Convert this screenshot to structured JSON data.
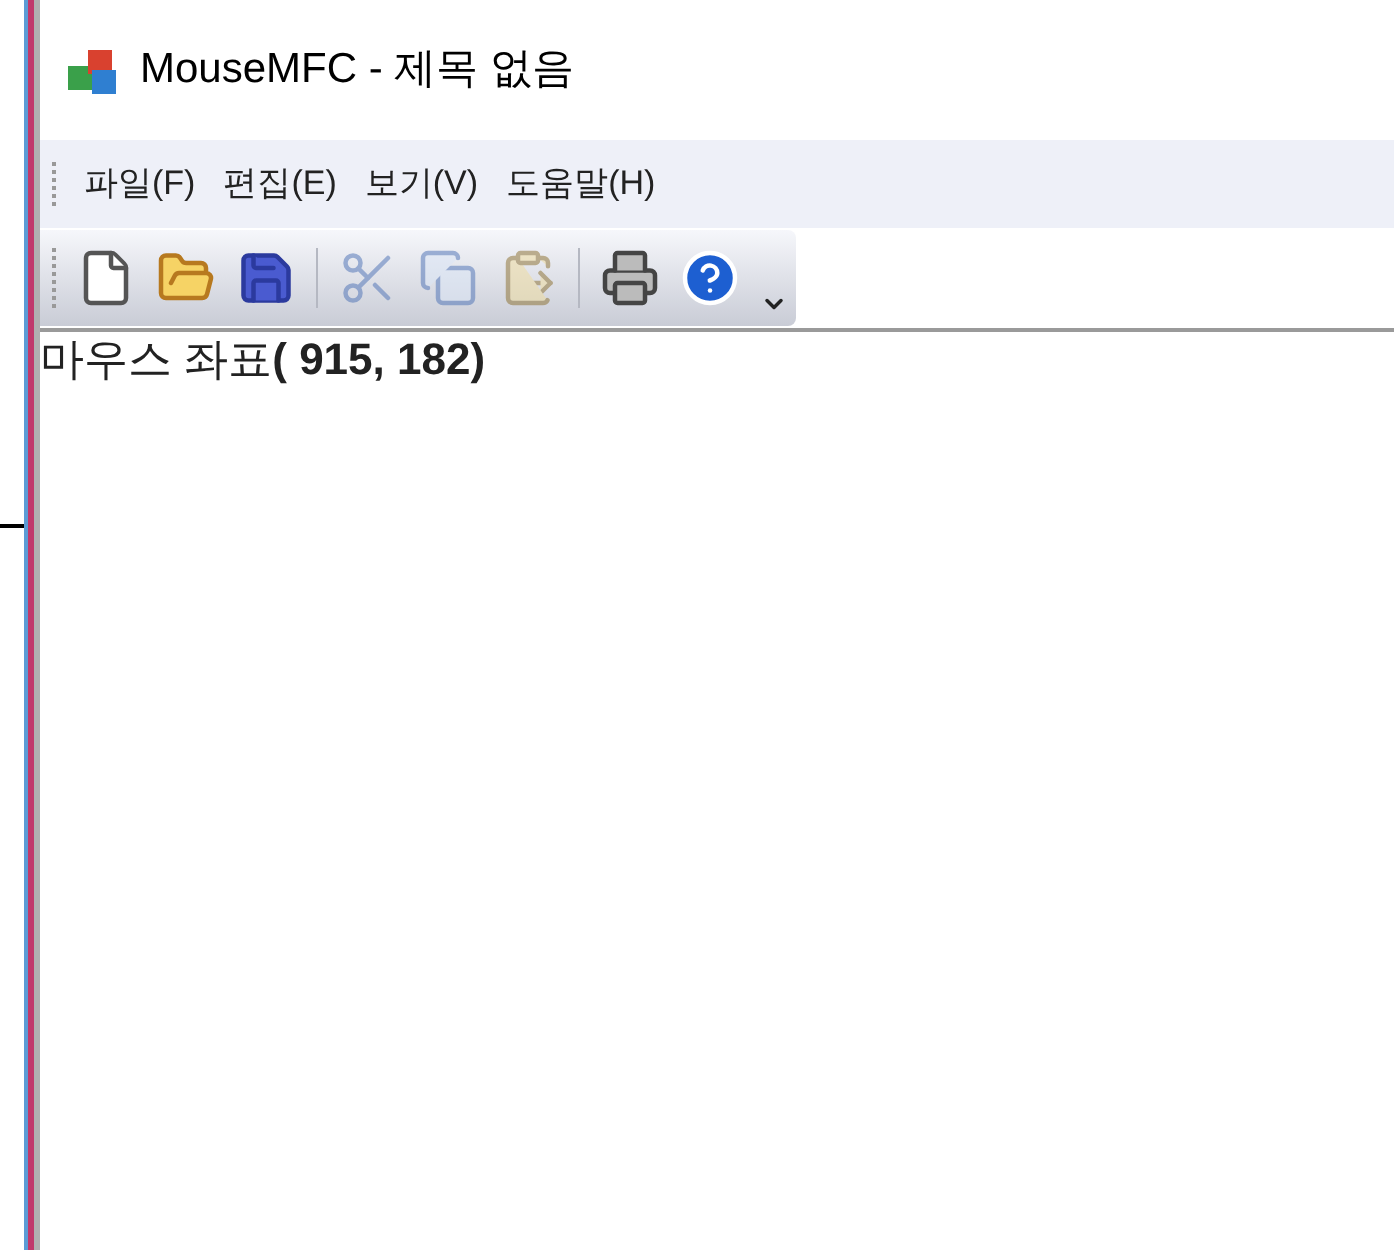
{
  "window": {
    "title": "MouseMFC - 제목 없음"
  },
  "menu": [
    {
      "label": "파일(F)"
    },
    {
      "label": "편집(E)"
    },
    {
      "label": "보기(V)"
    },
    {
      "label": "도움말(H)"
    }
  ],
  "toolbar": [
    {
      "kind": "new",
      "disabled": false
    },
    {
      "kind": "open",
      "disabled": false
    },
    {
      "kind": "save",
      "disabled": false
    },
    {
      "kind": "separator"
    },
    {
      "kind": "cut",
      "disabled": true
    },
    {
      "kind": "copy",
      "disabled": true
    },
    {
      "kind": "paste",
      "disabled": true
    },
    {
      "kind": "separator"
    },
    {
      "kind": "print",
      "disabled": false
    },
    {
      "kind": "help",
      "disabled": false
    }
  ],
  "content": {
    "text": "마우스 좌표**( 915, 182)**"
  }
}
